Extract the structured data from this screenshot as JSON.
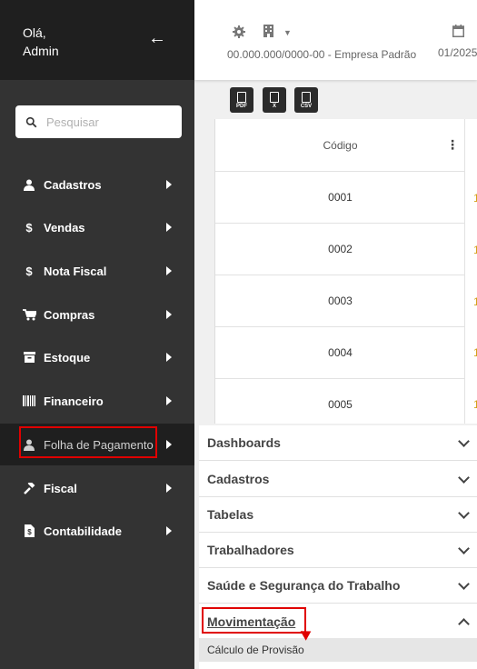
{
  "sidebar": {
    "greeting_line1": "Olá,",
    "greeting_line2": "Admin",
    "back_icon": "arrow-left-icon",
    "search": {
      "placeholder": "Pesquisar"
    },
    "items": [
      {
        "label": "Cadastros",
        "icon": "user-icon"
      },
      {
        "label": "Vendas",
        "icon": "dollar-icon"
      },
      {
        "label": "Nota Fiscal",
        "icon": "dollar-icon"
      },
      {
        "label": "Compras",
        "icon": "cart-icon"
      },
      {
        "label": "Estoque",
        "icon": "box-icon"
      },
      {
        "label": "Financeiro",
        "icon": "barcode-icon"
      },
      {
        "label": "Folha de Pagamento",
        "icon": "user-icon",
        "active": true
      },
      {
        "label": "Fiscal",
        "icon": "gavel-icon"
      },
      {
        "label": "Contabilidade",
        "icon": "file-dollar-icon"
      }
    ]
  },
  "topbar": {
    "company": "00.000.000/0000-00 - Empresa Padrão",
    "date": "01/2025"
  },
  "export_buttons": [
    "PDF",
    "X",
    "CSV"
  ],
  "table": {
    "header": "Código",
    "rows": [
      "0001",
      "0002",
      "0003",
      "0004",
      "0005"
    ],
    "next_col_glimpse": "1"
  },
  "submenu": {
    "items": [
      "Dashboards",
      "Cadastros",
      "Tabelas",
      "Trabalhadores",
      "Saúde e Segurança do Trabalho",
      "Movimentação"
    ],
    "open_item": "Movimentação",
    "sub_item": "Cálculo de Provisão"
  },
  "colors": {
    "sidebar": "#333333",
    "sidebar_header": "#1f1f1f",
    "highlight": "#e00000",
    "accent": "#d4a017"
  }
}
